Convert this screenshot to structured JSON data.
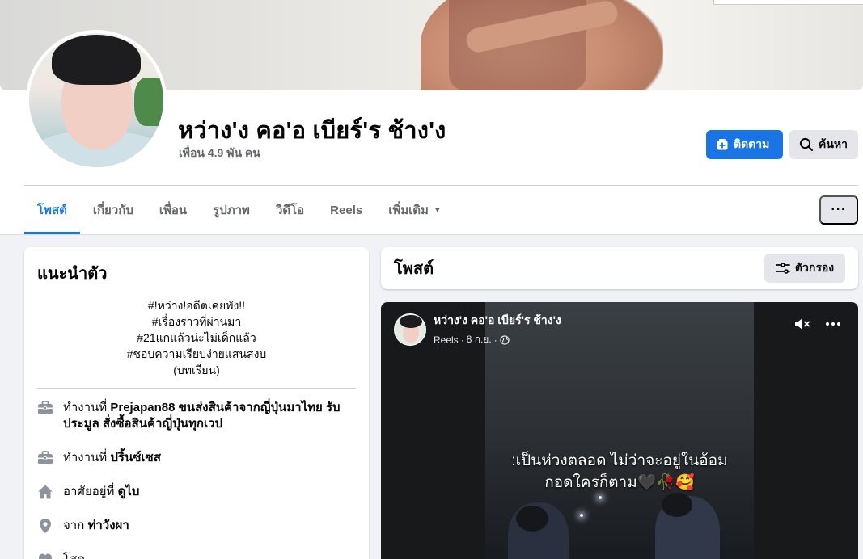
{
  "profile": {
    "name": "หว่าง'ง คอ'อ เบียร์'ร ช้าง'ง",
    "friends": "เพื่อน 4.9 พัน คน"
  },
  "actions": {
    "follow_label": "ติดตาม",
    "search_label": "ค้นหา",
    "more_label": "···"
  },
  "tabs": [
    {
      "label": "โพสต์",
      "active": true
    },
    {
      "label": "เกี่ยวกับ"
    },
    {
      "label": "เพื่อน"
    },
    {
      "label": "รูปภาพ"
    },
    {
      "label": "วิดีโอ"
    },
    {
      "label": "Reels"
    },
    {
      "label": "เพิ่มเติม"
    }
  ],
  "intro": {
    "title": "แนะนำตัว",
    "bio": [
      "#!หว่าง!อดีตเคยพัง!!",
      "#เรื่องราวที่ผ่านมา",
      "#21แกแล้วน่ะไม่เด็กแล้ว",
      "#ชอบความเรียบง่ายแสนสงบ",
      "(บทเรียน)"
    ],
    "items": [
      {
        "icon": "briefcase-icon",
        "prefix": "ทำงานที่",
        "value": "Prejapan88 ขนส่งสินค้าจากญี่ปุ่นมาไทย รับประมูล สั่งซื้อสินค้าญี่ปุ่นทุกเวป"
      },
      {
        "icon": "briefcase-icon",
        "prefix": "ทำงานที่",
        "value": "ปริ้นซ์เซส"
      },
      {
        "icon": "home-icon",
        "prefix": "อาศัยอยู่ที่",
        "value": "ดูไบ"
      },
      {
        "icon": "location-pin-icon",
        "prefix": "จาก",
        "value": "ท่าวังผา"
      },
      {
        "icon": "heart-icon",
        "prefix": "",
        "value": "โสด"
      }
    ]
  },
  "posts": {
    "title": "โพสต์",
    "filter_label": "ตัวกรอง"
  },
  "reel": {
    "author": "หว่าง'ง คอ'อ เบียร์'ร ช้าง'ง",
    "type": "Reels",
    "date": "8 ก.ย.",
    "caption_line1": ":เป็นห่วงตลอด ไม่ว่าจะอยู่ในอ้อม",
    "caption_line2": "กอดใครก็ตาม🖤🥀🥰"
  },
  "colors": {
    "accent": "#1b74e4",
    "secondary_text": "#65676b",
    "button_gray": "#e4e6eb"
  }
}
